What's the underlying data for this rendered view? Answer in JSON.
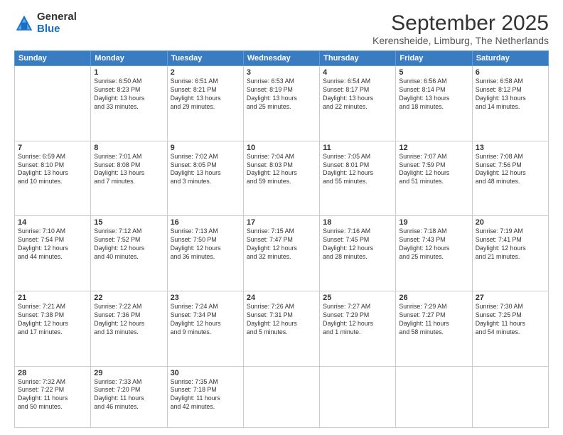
{
  "logo": {
    "general": "General",
    "blue": "Blue"
  },
  "title": "September 2025",
  "subtitle": "Kerensheide, Limburg, The Netherlands",
  "days_of_week": [
    "Sunday",
    "Monday",
    "Tuesday",
    "Wednesday",
    "Thursday",
    "Friday",
    "Saturday"
  ],
  "weeks": [
    [
      {
        "day": "",
        "info": ""
      },
      {
        "day": "1",
        "info": "Sunrise: 6:50 AM\nSunset: 8:23 PM\nDaylight: 13 hours\nand 33 minutes."
      },
      {
        "day": "2",
        "info": "Sunrise: 6:51 AM\nSunset: 8:21 PM\nDaylight: 13 hours\nand 29 minutes."
      },
      {
        "day": "3",
        "info": "Sunrise: 6:53 AM\nSunset: 8:19 PM\nDaylight: 13 hours\nand 25 minutes."
      },
      {
        "day": "4",
        "info": "Sunrise: 6:54 AM\nSunset: 8:17 PM\nDaylight: 13 hours\nand 22 minutes."
      },
      {
        "day": "5",
        "info": "Sunrise: 6:56 AM\nSunset: 8:14 PM\nDaylight: 13 hours\nand 18 minutes."
      },
      {
        "day": "6",
        "info": "Sunrise: 6:58 AM\nSunset: 8:12 PM\nDaylight: 13 hours\nand 14 minutes."
      }
    ],
    [
      {
        "day": "7",
        "info": "Sunrise: 6:59 AM\nSunset: 8:10 PM\nDaylight: 13 hours\nand 10 minutes."
      },
      {
        "day": "8",
        "info": "Sunrise: 7:01 AM\nSunset: 8:08 PM\nDaylight: 13 hours\nand 7 minutes."
      },
      {
        "day": "9",
        "info": "Sunrise: 7:02 AM\nSunset: 8:05 PM\nDaylight: 13 hours\nand 3 minutes."
      },
      {
        "day": "10",
        "info": "Sunrise: 7:04 AM\nSunset: 8:03 PM\nDaylight: 12 hours\nand 59 minutes."
      },
      {
        "day": "11",
        "info": "Sunrise: 7:05 AM\nSunset: 8:01 PM\nDaylight: 12 hours\nand 55 minutes."
      },
      {
        "day": "12",
        "info": "Sunrise: 7:07 AM\nSunset: 7:59 PM\nDaylight: 12 hours\nand 51 minutes."
      },
      {
        "day": "13",
        "info": "Sunrise: 7:08 AM\nSunset: 7:56 PM\nDaylight: 12 hours\nand 48 minutes."
      }
    ],
    [
      {
        "day": "14",
        "info": "Sunrise: 7:10 AM\nSunset: 7:54 PM\nDaylight: 12 hours\nand 44 minutes."
      },
      {
        "day": "15",
        "info": "Sunrise: 7:12 AM\nSunset: 7:52 PM\nDaylight: 12 hours\nand 40 minutes."
      },
      {
        "day": "16",
        "info": "Sunrise: 7:13 AM\nSunset: 7:50 PM\nDaylight: 12 hours\nand 36 minutes."
      },
      {
        "day": "17",
        "info": "Sunrise: 7:15 AM\nSunset: 7:47 PM\nDaylight: 12 hours\nand 32 minutes."
      },
      {
        "day": "18",
        "info": "Sunrise: 7:16 AM\nSunset: 7:45 PM\nDaylight: 12 hours\nand 28 minutes."
      },
      {
        "day": "19",
        "info": "Sunrise: 7:18 AM\nSunset: 7:43 PM\nDaylight: 12 hours\nand 25 minutes."
      },
      {
        "day": "20",
        "info": "Sunrise: 7:19 AM\nSunset: 7:41 PM\nDaylight: 12 hours\nand 21 minutes."
      }
    ],
    [
      {
        "day": "21",
        "info": "Sunrise: 7:21 AM\nSunset: 7:38 PM\nDaylight: 12 hours\nand 17 minutes."
      },
      {
        "day": "22",
        "info": "Sunrise: 7:22 AM\nSunset: 7:36 PM\nDaylight: 12 hours\nand 13 minutes."
      },
      {
        "day": "23",
        "info": "Sunrise: 7:24 AM\nSunset: 7:34 PM\nDaylight: 12 hours\nand 9 minutes."
      },
      {
        "day": "24",
        "info": "Sunrise: 7:26 AM\nSunset: 7:31 PM\nDaylight: 12 hours\nand 5 minutes."
      },
      {
        "day": "25",
        "info": "Sunrise: 7:27 AM\nSunset: 7:29 PM\nDaylight: 12 hours\nand 1 minute."
      },
      {
        "day": "26",
        "info": "Sunrise: 7:29 AM\nSunset: 7:27 PM\nDaylight: 11 hours\nand 58 minutes."
      },
      {
        "day": "27",
        "info": "Sunrise: 7:30 AM\nSunset: 7:25 PM\nDaylight: 11 hours\nand 54 minutes."
      }
    ],
    [
      {
        "day": "28",
        "info": "Sunrise: 7:32 AM\nSunset: 7:22 PM\nDaylight: 11 hours\nand 50 minutes."
      },
      {
        "day": "29",
        "info": "Sunrise: 7:33 AM\nSunset: 7:20 PM\nDaylight: 11 hours\nand 46 minutes."
      },
      {
        "day": "30",
        "info": "Sunrise: 7:35 AM\nSunset: 7:18 PM\nDaylight: 11 hours\nand 42 minutes."
      },
      {
        "day": "",
        "info": ""
      },
      {
        "day": "",
        "info": ""
      },
      {
        "day": "",
        "info": ""
      },
      {
        "day": "",
        "info": ""
      }
    ]
  ]
}
